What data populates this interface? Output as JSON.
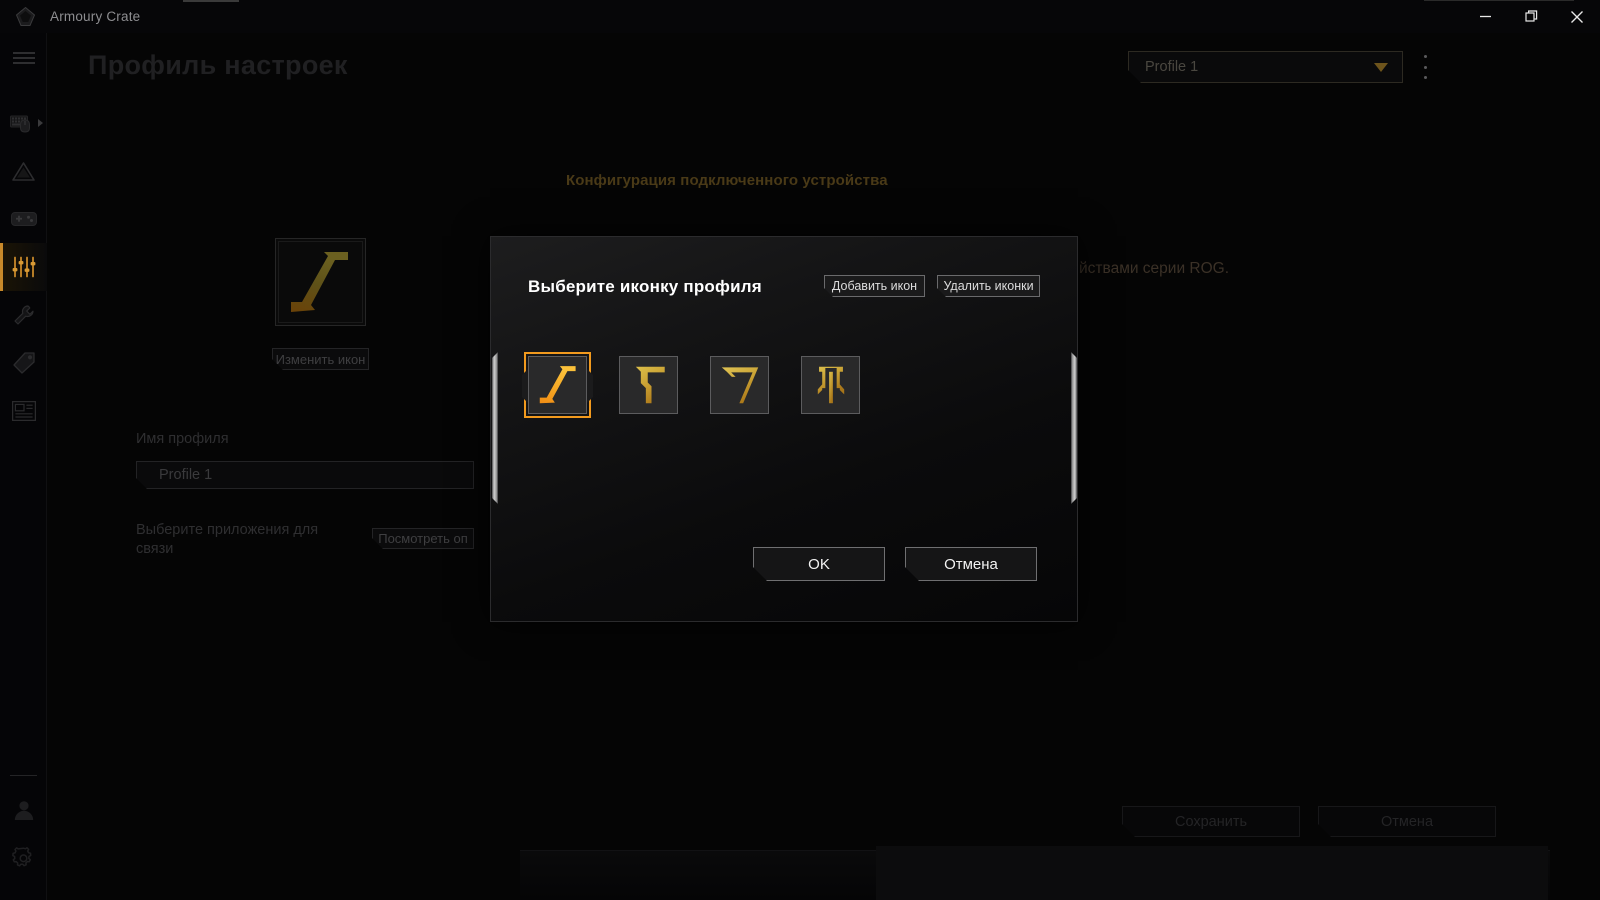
{
  "window": {
    "app_title": "Armoury Crate",
    "logo_icon": "rog-logo-icon",
    "minimize_icon": "minimize-icon",
    "maximize_icon": "maximize-restore-icon",
    "close_icon": "close-icon"
  },
  "sidebar": {
    "hamburger_icon": "hamburger-menu-icon",
    "items": [
      {
        "icon": "keyboard-mouse-devices-icon",
        "name": "devices"
      },
      {
        "icon": "aura-sync-triangle-icon",
        "name": "aura-sync"
      },
      {
        "icon": "gamepad-game-library-icon",
        "name": "game-library"
      },
      {
        "icon": "sliders-scenario-profiles-icon",
        "name": "scenario-profiles",
        "active": true
      },
      {
        "icon": "wrench-tools-icon",
        "name": "tools"
      },
      {
        "icon": "tag-deals-icon",
        "name": "deals"
      },
      {
        "icon": "news-window-icon",
        "name": "news"
      }
    ],
    "bottom_items": [
      {
        "icon": "user-account-icon",
        "name": "account"
      },
      {
        "icon": "gear-settings-icon",
        "name": "settings"
      }
    ]
  },
  "header": {
    "page_title": "Профиль настроек",
    "profile_dropdown_value": "Profile 1",
    "dropdown_caret_icon": "chevron-down-icon",
    "kebab_icon": "more-options-icon"
  },
  "background": {
    "section_title": "Конфигурация подключенного устройства",
    "rog_text": "йствами серии ROG.",
    "accent_color": "#4a3a17"
  },
  "form": {
    "icon_preview_name": "profile-icon-preview",
    "change_icon_label": "Изменить икон",
    "profile_name_label": "Имя профиля",
    "profile_name_value": "Profile 1",
    "apps_label": "Выберите приложения для связи",
    "view_options_label": "Посмотреть оп"
  },
  "footer": {
    "save_label": "Сохранить",
    "cancel_label": "Отмена"
  },
  "modal": {
    "title": "Выберите иконку профиля",
    "add_icon_label": "Добавить икон",
    "delete_icon_label": "Удалить иконки",
    "ok_label": "OK",
    "cancel_label": "Отмена",
    "selection_color": "#f29a1e",
    "icons": [
      {
        "name": "icon-slash-z",
        "selected": true
      },
      {
        "name": "icon-hook-gamma",
        "selected": false
      },
      {
        "name": "icon-chevron-v",
        "selected": false
      },
      {
        "name": "icon-trident-pi",
        "selected": false
      }
    ]
  }
}
